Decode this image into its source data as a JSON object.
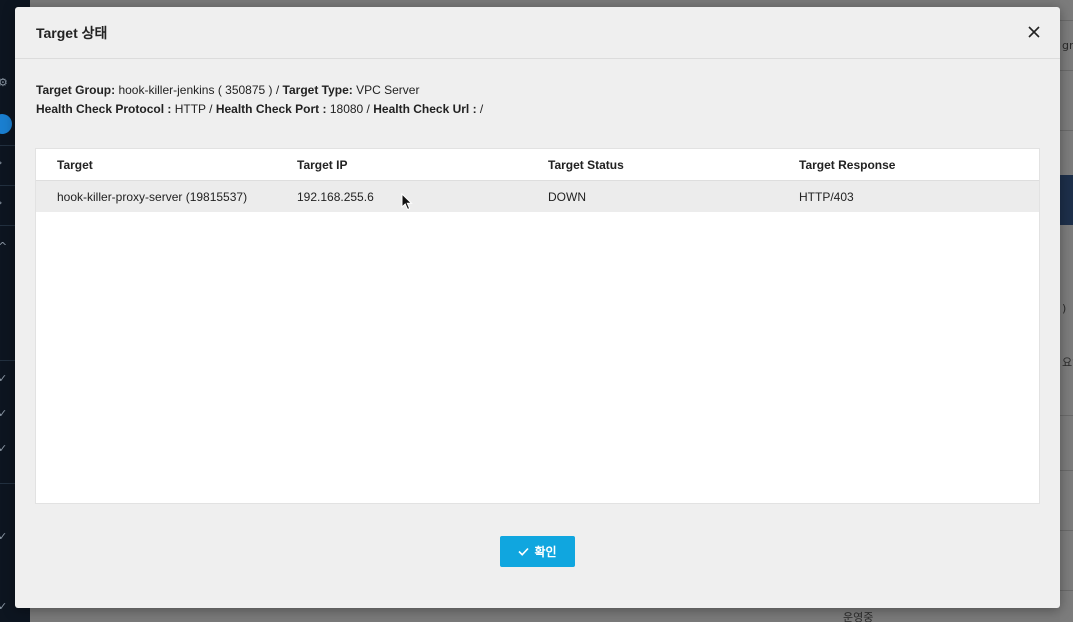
{
  "background": {
    "panel_text_1": "gr",
    "panel_text_2": ")",
    "panel_text_3": "요양",
    "footer_text": "운영중"
  },
  "modal": {
    "title": "Target 상태",
    "info": {
      "target_group_label": "Target Group:",
      "target_group_value": " hook-killer-jenkins ( 350875 ) / ",
      "target_type_label": "Target Type:",
      "target_type_value": " VPC Server",
      "health_protocol_label": "Health Check Protocol :",
      "health_protocol_value": " HTTP / ",
      "health_port_label": "Health Check Port :",
      "health_port_value": " 18080 / ",
      "health_url_label": "Health Check Url :",
      "health_url_value": " /"
    },
    "table": {
      "headers": [
        "Target",
        "Target IP",
        "Target Status",
        "Target Response"
      ],
      "rows": [
        [
          "hook-killer-proxy-server (19815537)",
          "192.168.255.6",
          "DOWN",
          "HTTP/403"
        ]
      ]
    },
    "confirm_label": "확인"
  },
  "colors": {
    "accent": "#10a6df"
  }
}
